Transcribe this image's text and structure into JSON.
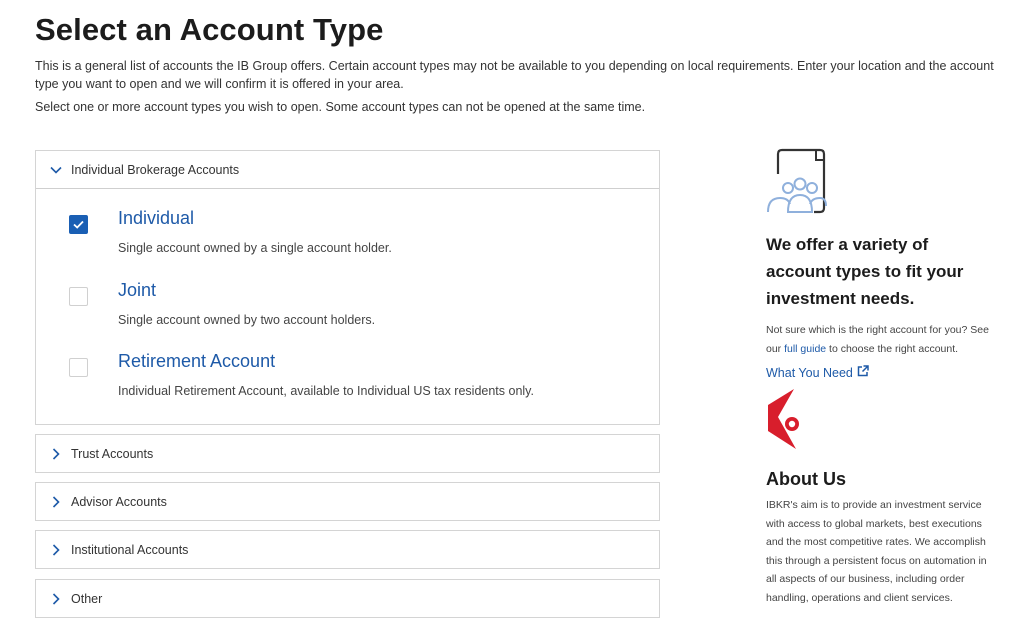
{
  "page": {
    "title": "Select an Account Type",
    "intro": "This is a general list of accounts the IB Group offers. Certain account types may not be available to you depending on local requirements. Enter your location and the account type you want to open and we will confirm it is offered in your area.",
    "instruction": "Select one or more account types you wish to open. Some account types can not be opened at the same time."
  },
  "accordion": {
    "individual": {
      "label": "Individual Brokerage Accounts",
      "options": [
        {
          "title": "Individual",
          "desc": "Single account owned by a single account holder.",
          "checked": true
        },
        {
          "title": "Joint",
          "desc": "Single account owned by two account holders.",
          "checked": false
        },
        {
          "title": "Retirement Account",
          "desc": "Individual Retirement Account, available to Individual US tax residents only.",
          "checked": false
        }
      ]
    },
    "trust": {
      "label": "Trust Accounts"
    },
    "advisor": {
      "label": "Advisor Accounts"
    },
    "institutional": {
      "label": "Institutional Accounts"
    },
    "other": {
      "label": "Other"
    }
  },
  "sidebar": {
    "heading": "We offer a variety of account types to fit your investment needs.",
    "text_before_link": "Not sure which is the right account for you? See our ",
    "link": "full guide",
    "text_after_link": " to choose the right account.",
    "what_you_need": "What You Need",
    "about_heading": "About Us",
    "about_text": "IBKR's aim is to provide an investment service with access to global markets, best executions and the most competitive rates. We accomplish this through a persistent focus on automation in all aspects of our business, including order handling, operations and client services."
  },
  "colors": {
    "accent": "#1e5aa8",
    "checkbox": "#1a5fb4",
    "logo_red": "#d81e2c",
    "icon_gray": "#333333",
    "icon_blue": "#8fb0dc"
  },
  "icons": [
    "chevron-down-icon",
    "chevron-right-icon",
    "checkmark-icon",
    "users-document-icon",
    "external-link-icon",
    "ibkr-logo-icon"
  ]
}
